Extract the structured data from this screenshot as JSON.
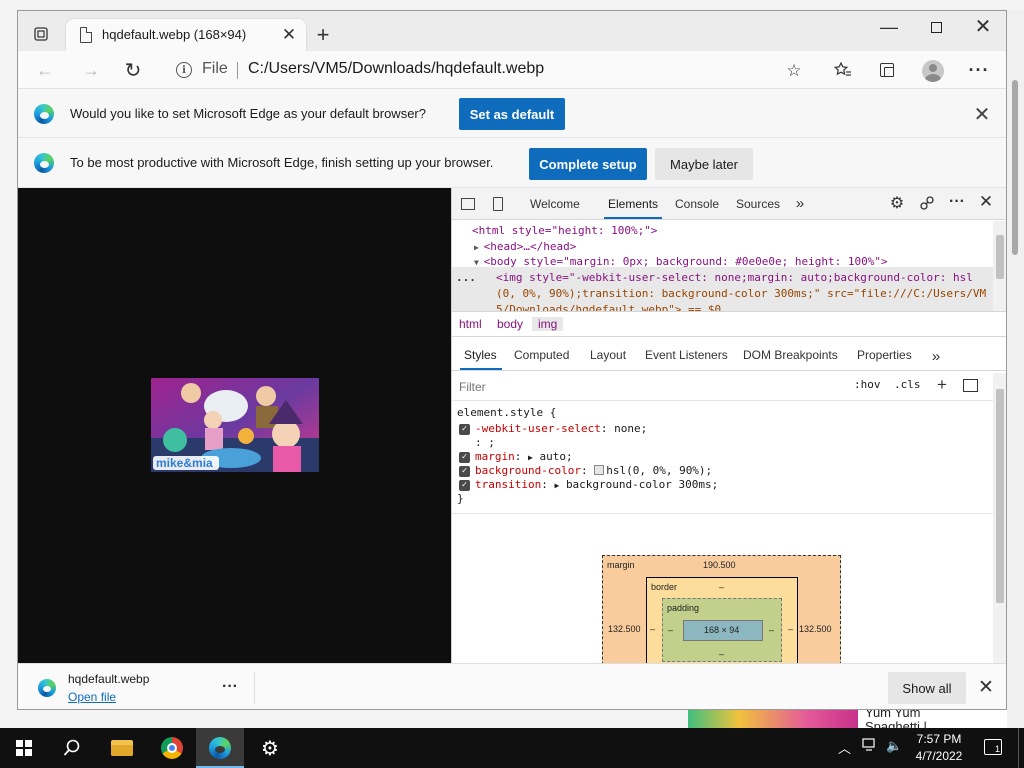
{
  "window": {
    "tab_title": "hqdefault.webp (168×94)",
    "new_tab_symbol": "+",
    "controls": {
      "minimize": "—",
      "maximize_icon": "maximize-icon",
      "close": "✕"
    }
  },
  "toolbar": {
    "back_symbol": "←",
    "forward_symbol": "→",
    "refresh_symbol": "↻",
    "scheme_label": "File",
    "url": "C:/Users/VM5/Downloads/hqdefault.webp",
    "add_favorite_symbol": "☆",
    "favorites_symbol": "☆",
    "menu_symbol": "···"
  },
  "infobars": {
    "default_browser": {
      "message": "Would you like to set Microsoft Edge as your default browser?",
      "button": "Set as default",
      "close_symbol": "✕"
    },
    "setup": {
      "message": "To be most productive with Microsoft Edge, finish setting up your browser.",
      "primary_button": "Complete setup",
      "secondary_button": "Maybe later"
    }
  },
  "viewer": {
    "image_caption": "mike&mia"
  },
  "devtools": {
    "tabs": [
      "Welcome",
      "Elements",
      "Console",
      "Sources"
    ],
    "more_tabs_symbol": "»",
    "settings_symbol": "⚙",
    "kebab_symbol": "···",
    "close_symbol": "✕",
    "dom": {
      "line1": "<html style=\"height: 100%;\">",
      "line2": "<head>…</head>",
      "line3": "<body style=\"margin: 0px; background: #0e0e0e; height: 100%\">",
      "dots": "...",
      "line4": "<img style=\"-webkit-user-select: none;margin: auto;background-color: hsl",
      "line5": "(0, 0%, 90%);transition: background-color 300ms;\" src=\"file:///C:/Users/VM",
      "line6": "5/Downloads/hqdefault.webp\"> == $0"
    },
    "breadcrumbs": [
      "html",
      "body",
      "img"
    ],
    "subtabs": [
      "Styles",
      "Computed",
      "Layout",
      "Event Listeners",
      "DOM Breakpoints",
      "Properties"
    ],
    "filter_placeholder": "Filter",
    "hov_label": ":hov",
    "cls_label": ".cls",
    "add_rule_symbol": "+",
    "styles": {
      "selector": "element.style {",
      "rules": [
        {
          "prop": "-webkit-user-select",
          "value": "none;"
        },
        {
          "prop": "margin",
          "value": "auto;"
        },
        {
          "prop": "background-color",
          "value": "hsl(0, 0%, 90%);"
        },
        {
          "prop": "transition",
          "value": "background-color 300ms;"
        }
      ],
      "editing_line": ": ;",
      "close_brace": "}"
    },
    "box_model": {
      "margin_label": "margin",
      "margin_top": "190.500",
      "margin_left": "132.500",
      "margin_right": "132.500",
      "border_label": "border",
      "border_value": "–",
      "padding_label": "padding",
      "padding_value": "–",
      "content_size": "168 × 94"
    }
  },
  "download": {
    "filename": "hqdefault.webp",
    "open_label": "Open file",
    "more_symbol": "···",
    "show_all": "Show all",
    "close_symbol": "✕"
  },
  "desktop_peek_text": "Yum Yum\nSpaghetti |",
  "taskbar": {
    "time": "7:57 PM",
    "date": "4/7/2022",
    "notification_count": "1"
  }
}
